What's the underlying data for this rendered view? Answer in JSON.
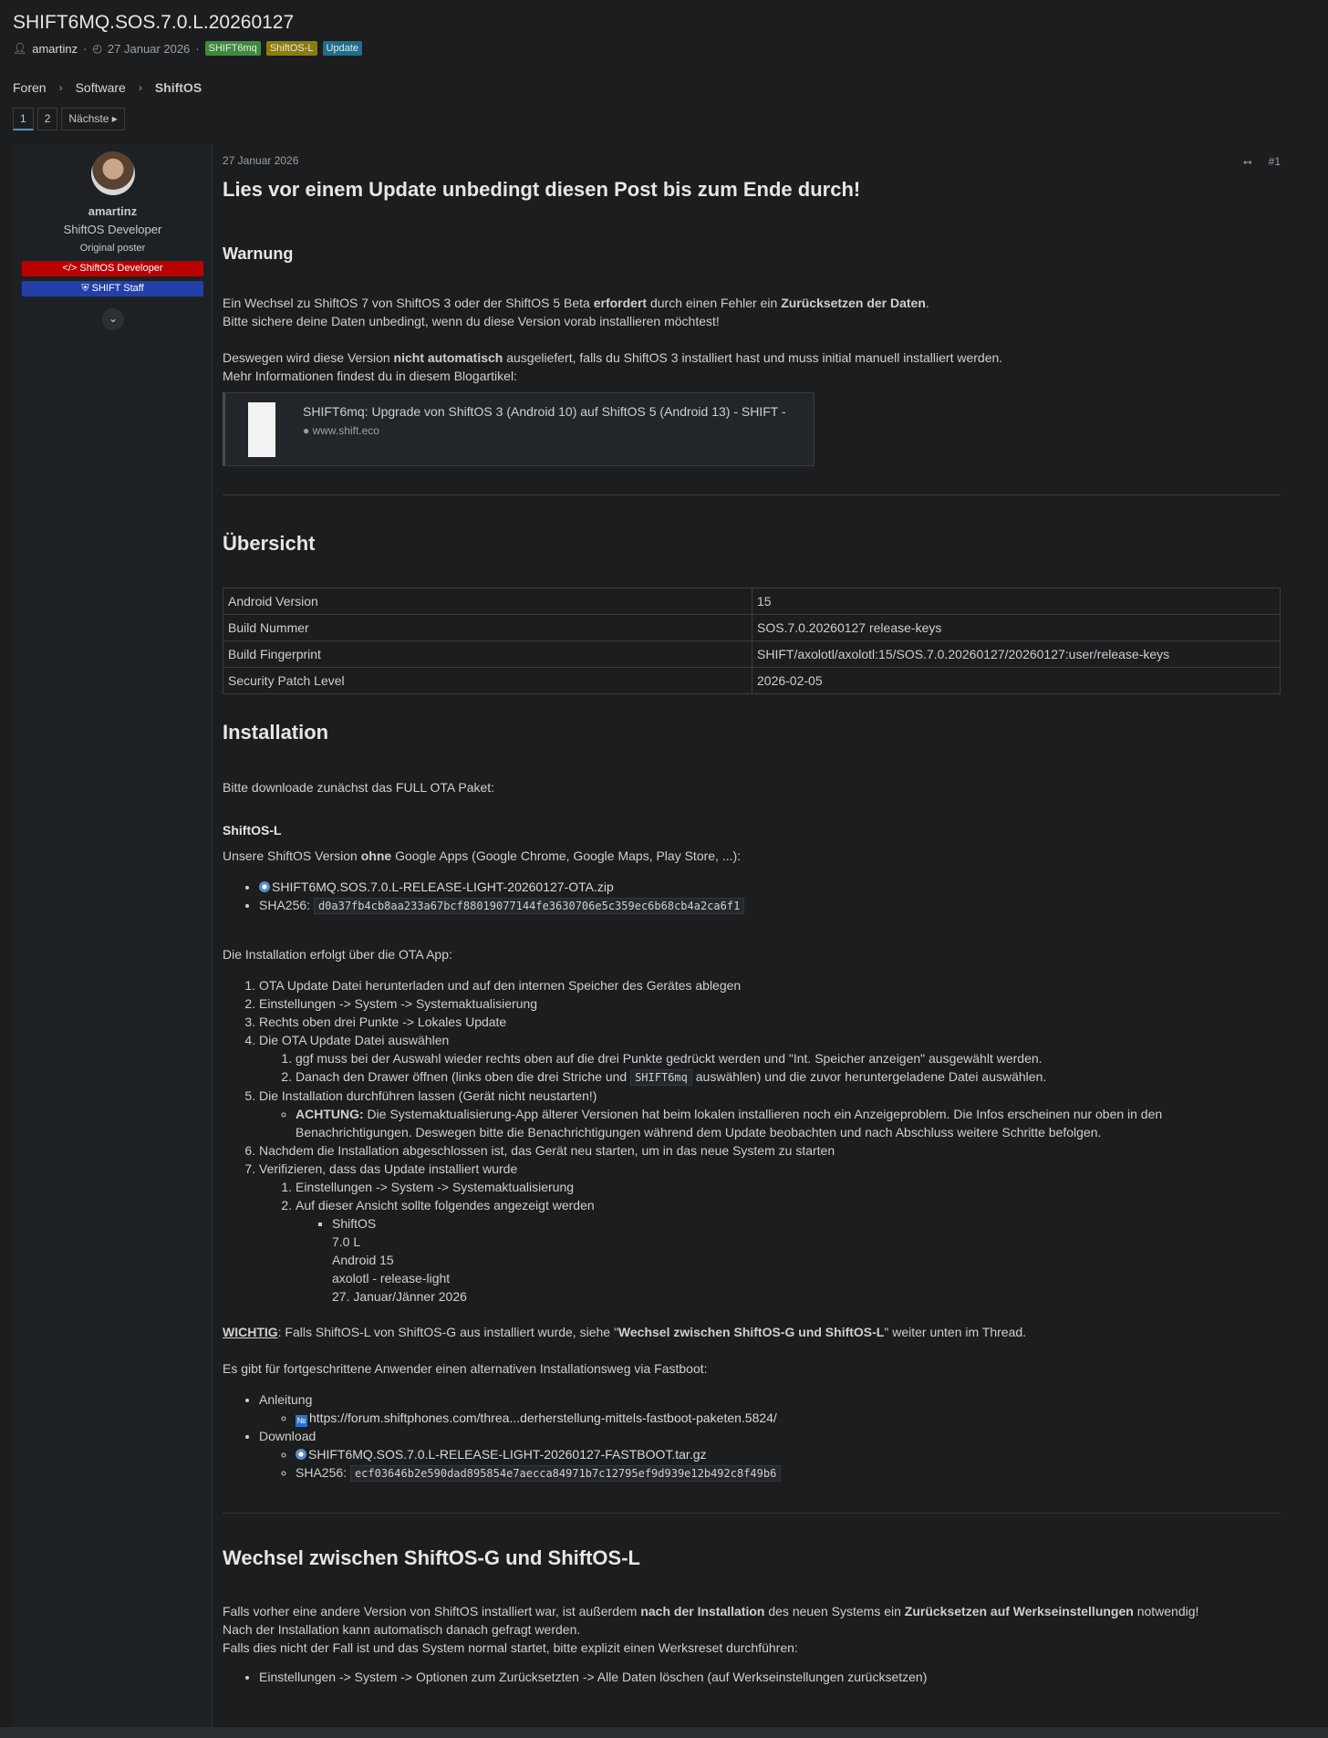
{
  "thread": {
    "title": "SHIFT6MQ.SOS.7.0.L.20260127",
    "author": "amartinz",
    "date": "27 Januar 2026",
    "tags": [
      "SHIFT6mq",
      "ShiftOS-L",
      "Update"
    ]
  },
  "breadcrumb": {
    "items": [
      "Foren",
      "Software",
      "ShiftOS"
    ]
  },
  "pager": {
    "pages": [
      "1",
      "2"
    ],
    "next_label": "Nächste"
  },
  "author_card": {
    "name": "amartinz",
    "title": "ShiftOS Developer",
    "op_label": "Original poster",
    "banners": [
      "ShiftOS Developer",
      "SHIFT Staff"
    ]
  },
  "post": {
    "date": "27 Januar 2026",
    "number": "#1",
    "heading": "Lies vor einem Update unbedingt diesen Post bis zum Ende durch!",
    "warning_title": "Warnung",
    "p1_pre": "Ein Wechsel zu ShiftOS 7 von ShiftOS 3 oder der ShiftOS 5 Beta ",
    "p1_bold1": "erfordert",
    "p1_mid": " durch einen Fehler ein ",
    "p1_bold2": "Zurücksetzen der Daten",
    "p1_end": ".",
    "p2": "Bitte sichere deine Daten unbedingt, wenn du diese Version vorab installieren möchtest!",
    "p3_pre": "Deswegen wird diese Version ",
    "p3_bold": "nicht automatisch",
    "p3_end": " ausgeliefert, falls du ShiftOS 3 installiert hast und muss initial manuell installiert werden.",
    "p4": "Mehr Informationen findest du in diesem Blogartikel:",
    "link_title": "SHIFT6mq: Upgrade von ShiftOS 3 (Android 10) auf ShiftOS 5 (Android 13) - SHIFT -",
    "link_domain": "www.shift.eco",
    "overview_title": "Übersicht",
    "overview_rows": [
      [
        "Android Version",
        "15"
      ],
      [
        "Build Nummer",
        "SOS.7.0.20260127 release-keys"
      ],
      [
        "Build Fingerprint",
        "SHIFT/axolotl/axolotl:15/SOS.7.0.20260127/20260127:user/release-keys"
      ],
      [
        "Security Patch Level",
        "2026-02-05"
      ]
    ],
    "install_title": "Installation",
    "install_intro": "Bitte downloade zunächst das FULL OTA Paket:",
    "shiftos_l_title": "ShiftOS-L",
    "shiftos_l_pre": "Unsere ShiftOS Version ",
    "shiftos_l_bold": "ohne",
    "shiftos_l_end": " Google Apps (Google Chrome, Google Maps, Play Store, ...):",
    "ota_file": "SHIFT6MQ.SOS.7.0.L-RELEASE-LIGHT-20260127-OTA.zip",
    "sha_label": "SHA256:",
    "ota_sha": "d0a37fb4cb8aa233a67bcf88019077144fe3630706e5c359ec6b68cb4a2ca6f1",
    "ota_app_intro": "Die Installation erfolgt über die OTA App:",
    "step1": "OTA Update Datei herunterladen und auf den internen Speicher des Gerätes ablegen",
    "step2": "Einstellungen -> System -> Systemaktualisierung",
    "step3": "Rechts oben drei Punkte -> Lokales Update",
    "step4": "Die OTA Update Datei auswählen",
    "step4_1": "ggf muss bei der Auswahl wieder rechts oben auf die drei Punkte gedrückt werden und \"Int. Speicher anzeigen\" ausgewählt werden.",
    "step4_2_pre": "Danach den Drawer öffnen (links oben die drei Striche und ",
    "step4_2_code": "SHIFT6mq",
    "step4_2_end": " auswählen) und die zuvor heruntergeladene Datei auswählen.",
    "step5": "Die Installation durchführen lassen (Gerät nicht neustarten!)",
    "step5_bold": "ACHTUNG:",
    "step5_note": " Die Systemaktualisierung-App älterer Versionen hat beim lokalen installieren noch ein Anzeigeproblem. Die Infos erscheinen nur oben in den Benachrichtigungen. Deswegen bitte die Benachrichtigungen während dem Update beobachten und nach Abschluss weitere Schritte befolgen.",
    "step6": "Nachdem die Installation abgeschlossen ist, das Gerät neu starten, um in das neue System zu starten",
    "step7": "Verifizieren, dass das Update installiert wurde",
    "step7_1": "Einstellungen -> System -> Systemaktualisierung",
    "step7_2": "Auf dieser Ansicht sollte folgendes angezeigt werden",
    "verify_lines": [
      "ShiftOS",
      "7.0 L",
      "Android 15",
      "axolotl - release-light",
      "27. Januar/Jänner 2026"
    ],
    "wichtig_label": "WICHTIG",
    "wichtig_pre": ": Falls ShiftOS-L von ShiftOS-G aus installiert wurde, siehe \"",
    "wichtig_bold": "Wechsel zwischen ShiftOS-G und ShiftOS-L",
    "wichtig_end": "\" weiter unten im Thread.",
    "fastboot_intro": "Es gibt für fortgeschrittene Anwender einen alternativen Installationsweg via Fastboot:",
    "anleitung_label": "Anleitung",
    "anleitung_link": "https://forum.shiftphones.com/threa...derherstellung-mittels-fastboot-paketen.5824/",
    "download_label": "Download",
    "fastboot_file": "SHIFT6MQ.SOS.7.0.L-RELEASE-LIGHT-20260127-FASTBOOT.tar.gz",
    "fastboot_sha": "ecf03646b2e590dad895854e7aecca84971b7c12795ef9d939e12b492c8f49b6",
    "switch_title": "Wechsel zwischen ShiftOS-G und ShiftOS-L",
    "switch_p1_pre": "Falls vorher eine andere Version von ShiftOS installiert war, ist außerdem ",
    "switch_p1_bold1": "nach der Installation",
    "switch_p1_mid": " des neuen Systems ein ",
    "switch_p1_bold2": "Zurücksetzen auf Werkseinstellungen",
    "switch_p1_end": " notwendig!",
    "switch_p2": "Nach der Installation kann automatisch danach gefragt werden.",
    "switch_p3": "Falls dies nicht der Fall ist und das System normal startet, bitte explizit einen Werksreset durchführen:",
    "switch_item": "Einstellungen -> System -> Optionen zum Zurücksetzten -> Alle Daten löschen (auf Werkseinstellungen zurücksetzen)"
  }
}
